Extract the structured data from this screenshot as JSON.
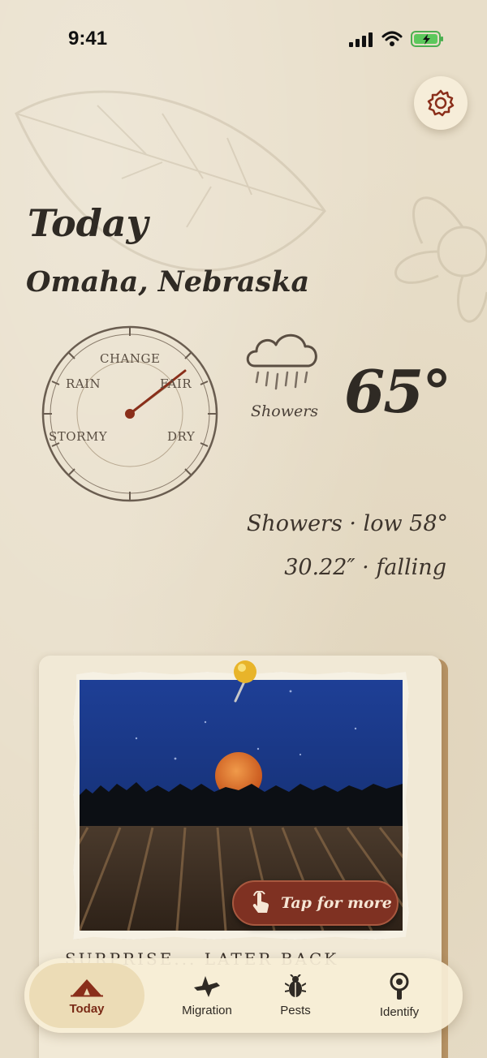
{
  "status_bar": {
    "time": "9:41"
  },
  "header": {
    "title": "Today",
    "location": "Omaha, Nebraska"
  },
  "barometer": {
    "labels": {
      "change": "CHANGE",
      "rain": "RAIN",
      "fair": "FAIR",
      "stormy": "STORMY",
      "dry": "DRY"
    }
  },
  "weather": {
    "icon": "rain-cloud-icon",
    "condition_label": "Showers",
    "temperature": "65°",
    "summary_line": "Showers · low 58°",
    "pressure_line": "30.22″ · falling"
  },
  "card": {
    "cta_label": "Tap for more",
    "caption": "SURPRISE... LATER BACK"
  },
  "tabs": [
    {
      "label": "Today",
      "icon": "tent-icon",
      "active": true
    },
    {
      "label": "Migration",
      "icon": "bird-icon",
      "active": false
    },
    {
      "label": "Pests",
      "icon": "beetle-icon",
      "active": false
    },
    {
      "label": "Identify",
      "icon": "magnifier-icon",
      "active": false
    }
  ],
  "colors": {
    "accent": "#7f3122",
    "background": "#e8dec9",
    "tab_active": "#7a2a16"
  }
}
